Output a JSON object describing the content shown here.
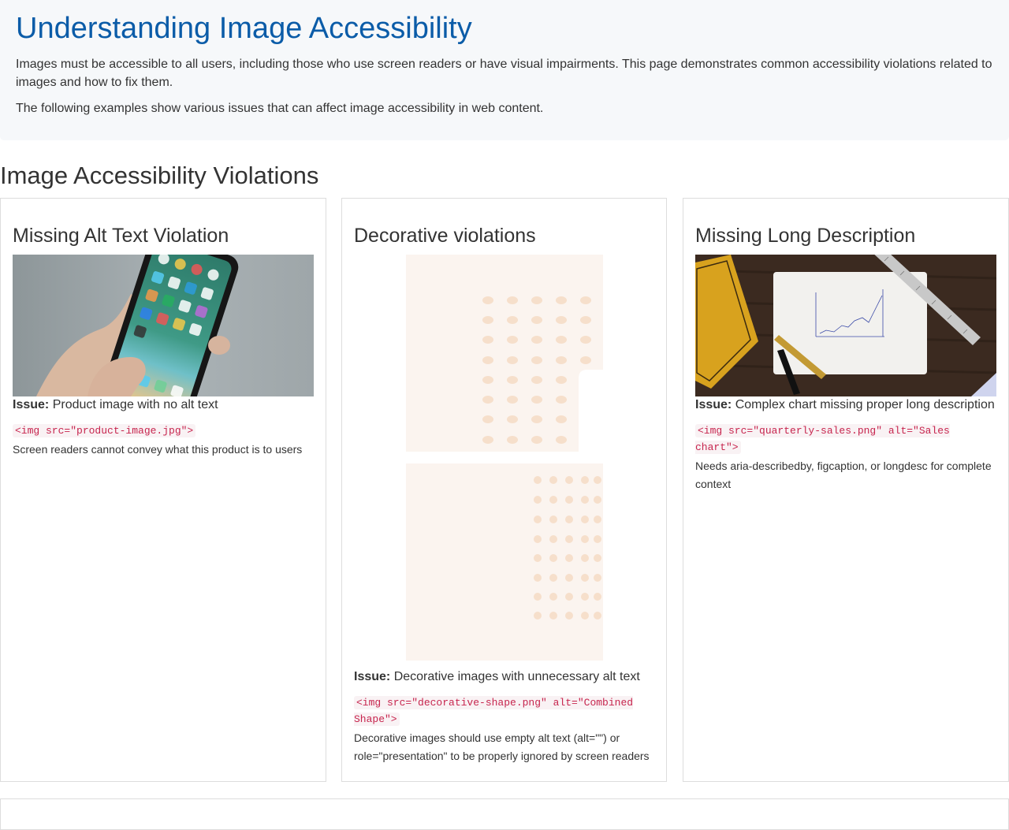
{
  "page": {
    "title": "Understanding Image Accessibility",
    "intro_1": "Images must be accessible to all users, including those who use screen readers or have visual impairments. This page demonstrates common accessibility violations related to images and how to fix them.",
    "intro_2": "The following examples show various issues that can affect image accessibility in web content."
  },
  "section": {
    "title": "Image Accessibility Violations"
  },
  "issue_label": "Issue:",
  "cards": [
    {
      "title": "Missing Alt Text Violation",
      "image": "phone-photo",
      "issue": "Product image with no alt text",
      "code": "<img src=\"product-image.jpg\">",
      "note": "Screen readers cannot convey what this product is to users"
    },
    {
      "title": "Decorative violations",
      "image": "decorative-dot-shape",
      "issue": "Decorative images with unnecessary alt text",
      "code": "<img src=\"decorative-shape.png\" alt=\"Combined Shape\">",
      "note": "Decorative images should use empty alt text (alt=\"\") or role=\"presentation\" to be properly ignored by screen readers"
    },
    {
      "title": "Missing Long Description",
      "image": "chart-desk-photo",
      "issue": "Complex chart missing proper long description",
      "code": "<img src=\"quarterly-sales.png\" alt=\"Sales chart\">",
      "note": "Needs aria-describedby, figcaption, or longdesc for complete context"
    }
  ],
  "colors": {
    "heading_blue": "#0b5ca8",
    "code_text": "#c7254e",
    "code_bg": "#f9f2f4",
    "intro_bg": "#f6f8fa",
    "decorative_fill": "#fbf4ef",
    "decorative_dots": "#f6dfcb"
  }
}
